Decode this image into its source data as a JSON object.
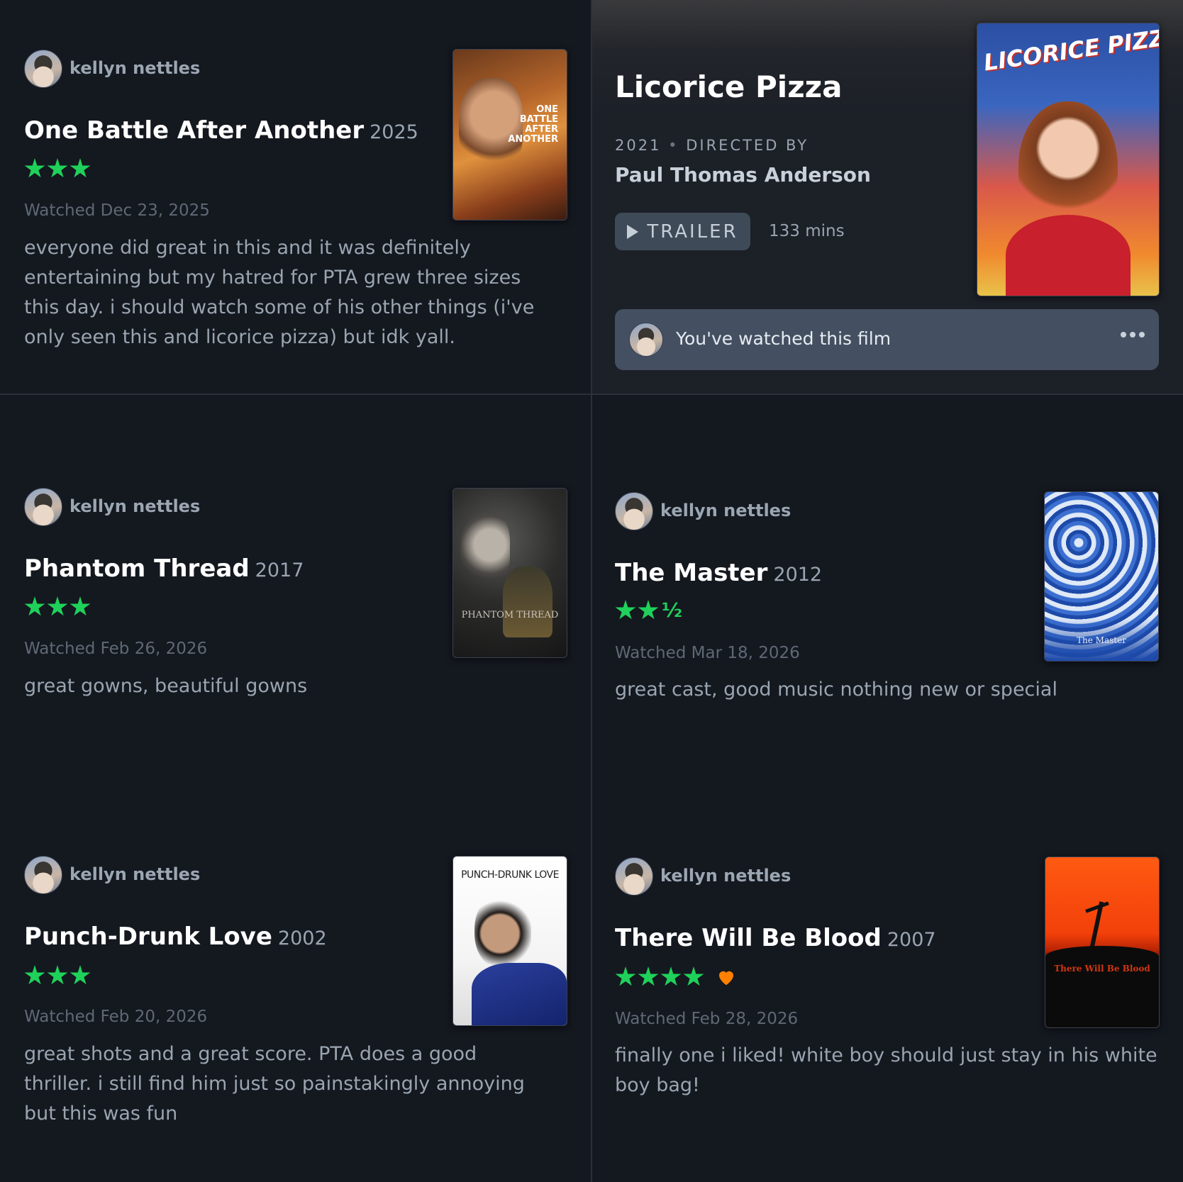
{
  "reviews": [
    {
      "username": "kellyn nettles",
      "title": "One Battle After Another",
      "year": "2025",
      "stars": 3,
      "half": false,
      "liked": false,
      "watched": "Watched Dec 23, 2025",
      "review": "everyone did great in this and it was definitely entertaining but my hatred for PTA grew three sizes this day. i should watch some of his other things (i've only seen this and licorice pizza) but idk yall.",
      "poster_text": "ONE BATTLE AFTER ANOTHER"
    },
    {
      "username": "kellyn nettles",
      "title": "Phantom Thread",
      "year": "2017",
      "stars": 3,
      "half": false,
      "liked": false,
      "watched": "Watched Feb 26, 2026",
      "review": "great gowns, beautiful gowns",
      "poster_text": "PHANTOM THREAD"
    },
    {
      "username": "kellyn nettles",
      "title": "The Master",
      "year": "2012",
      "stars": 2,
      "half": true,
      "half_glyph": "½",
      "liked": false,
      "watched": "Watched Mar 18, 2026",
      "review": "great cast, good music nothing new or special",
      "poster_text": "The Master"
    },
    {
      "username": "kellyn nettles",
      "title": "Punch-Drunk Love",
      "year": "2002",
      "stars": 3,
      "half": false,
      "liked": false,
      "watched": "Watched Feb 20, 2026",
      "review": "great shots and a great score. PTA does a good thriller. i still find him just so painstakingly annoying but this was fun",
      "poster_text": "PUNCH-DRUNK LOVE"
    },
    {
      "username": "kellyn nettles",
      "title": "There Will Be Blood",
      "year": "2007",
      "stars": 4,
      "half": false,
      "liked": true,
      "watched": "Watched Feb 28, 2026",
      "review": "finally one i liked! white boy should just stay in his white boy bag!",
      "poster_text": "There Will Be Blood"
    }
  ],
  "film": {
    "title": "Licorice Pizza",
    "year": "2021",
    "separator": "•",
    "directed_by": "DIRECTED BY",
    "director": "Paul Thomas Anderson",
    "trailer_label": "TRAILER",
    "runtime": "133 mins",
    "watched_status": "You've watched this film",
    "poster_text": "LICORICE PIZZA",
    "more_icon": "more-dots-icon"
  },
  "colors": {
    "background": "#14181f",
    "star_green": "#1fd15a",
    "heart_orange": "#ff8000",
    "divider": "#2b313b"
  }
}
